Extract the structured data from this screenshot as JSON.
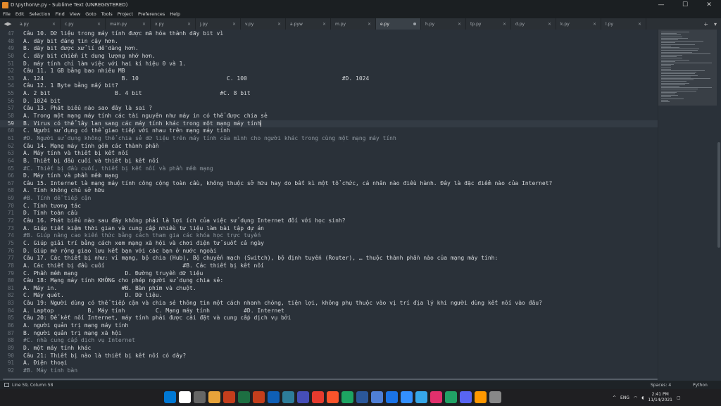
{
  "window": {
    "title": "D:\\python\\e.py - Sublime Text (UNREGISTERED)",
    "minimize": "—",
    "maximize": "☐",
    "close": "✕"
  },
  "menu": [
    "File",
    "Edit",
    "Selection",
    "Find",
    "View",
    "Goto",
    "Tools",
    "Project",
    "Preferences",
    "Help"
  ],
  "tabs": [
    {
      "label": "a.py",
      "active": false
    },
    {
      "label": "c.py",
      "active": false
    },
    {
      "label": "main.py",
      "active": false
    },
    {
      "label": "x.py",
      "active": false
    },
    {
      "label": "j.py",
      "active": false
    },
    {
      "label": "v.py",
      "active": false
    },
    {
      "label": "a.pyw",
      "active": false
    },
    {
      "label": "m.py",
      "active": false
    },
    {
      "label": "e.py",
      "active": true
    },
    {
      "label": "h.py",
      "active": false
    },
    {
      "label": "tp.py",
      "active": false
    },
    {
      "label": "d.py",
      "active": false
    },
    {
      "label": "k.py",
      "active": false
    },
    {
      "label": "l.py",
      "active": false
    }
  ],
  "tab_nav": {
    "prev": "◀",
    "next": "▶",
    "add": "+",
    "more": "▾"
  },
  "editor": {
    "current_line": 59,
    "lines": [
      {
        "n": "47",
        "t": "Câu 10. Dữ liệu trong máy tính được mã hóa thành dãy bit vì",
        "c": false
      },
      {
        "n": "48",
        "t": "A. dãy bit đáng tin cậy hơn.",
        "c": false
      },
      {
        "n": "49",
        "t": "B. dãy bit được xử lí dễ dàng hơn.",
        "c": false
      },
      {
        "n": "50",
        "t": "C. dãy bit chiếm ít dung lượng nhớ hơn.",
        "c": false
      },
      {
        "n": "51",
        "t": "D. máy tính chỉ làm việc với hai kí hiệu 0 và 1.",
        "c": false
      },
      {
        "n": "52",
        "t": "Câu 11. 1 GB bằng bao nhiêu MB",
        "c": false
      },
      {
        "n": "53",
        "t": "A. 124                       B. 10                          C. 100                            #D. 1024",
        "c": false
      },
      {
        "n": "54",
        "t": "Câu 12. 1 Byte bằng mấy bit?",
        "c": false
      },
      {
        "n": "55",
        "t": "A. 2 bit                   B. 4 bit                       #C. 8 bit",
        "c": false
      },
      {
        "n": "56",
        "t": "D. 1024 bit",
        "c": false
      },
      {
        "n": "57",
        "t": "Câu 13. Phát biểu nào sao đây là sai ?",
        "c": false
      },
      {
        "n": "58",
        "t": "A. Trong một mạng máy tính các tài nguyên như máy in có thể được chia sẻ",
        "c": false
      },
      {
        "n": "59",
        "t": "B. Virus có thể lây lan sang các máy tính khác trong một mạng máy tính",
        "c": false
      },
      {
        "n": "60",
        "t": "C. Người sử dụng có thể giao tiếp với nhau trên mạng máy tính",
        "c": false
      },
      {
        "n": "61",
        "t": "#D. Người sử dụng không thể chia sẻ dữ liệu trên máy tính của mình cho người khác trong cùng một mạng máy tính",
        "c": true
      },
      {
        "n": "62",
        "t": "Câu 14. Mạng máy tính gồm các thành phần",
        "c": false
      },
      {
        "n": "63",
        "t": "A. Máy tính và thiết bị kết nối",
        "c": false
      },
      {
        "n": "64",
        "t": "B. Thiết bị đầu cuối và thiết bị kết nối",
        "c": false
      },
      {
        "n": "65",
        "t": "#C. Thiết bị đầu cuối, thiết bị kết nối và phần mềm mạng",
        "c": true
      },
      {
        "n": "66",
        "t": "D. Máy tính và phần mềm mạng",
        "c": false
      },
      {
        "n": "67",
        "t": "Câu 15. Internet là mạng máy tính công cộng toàn cầu, không thuộc sở hữu hay do bất kì một tổ chức, cá nhân nào điều hành. Đây là đặc điểm nào của Internet?",
        "c": false
      },
      {
        "n": "68",
        "t": "A. Tính không chủ sở hữu",
        "c": false
      },
      {
        "n": "69",
        "t": "#B. Tính dễ tiếp cận",
        "c": true
      },
      {
        "n": "70",
        "t": "C. Tính tương tác",
        "c": false
      },
      {
        "n": "71",
        "t": "D. Tính toàn cầu",
        "c": false
      },
      {
        "n": "72",
        "t": "Câu 16. Phát biểu nào sau đây không phải là lợi ích của việc sử dụng Internet đối với học sinh?",
        "c": false
      },
      {
        "n": "73",
        "t": "A. Giúp tiết kiệm thời gian và cung cấp nhiều tư liệu làm bài tập dự án",
        "c": false
      },
      {
        "n": "74",
        "t": "#B. Giúp nâng cao kiến thức bằng cách tham gia các khóa học trực tuyến",
        "c": true
      },
      {
        "n": "75",
        "t": "C. Giúp giải trí bằng cách xem mạng xã hội và chơi điện tử suốt cả ngày",
        "c": false
      },
      {
        "n": "76",
        "t": "D. Giúp mở rộng giao lưu kết bạn với các bạn ở nước ngoài",
        "c": false
      },
      {
        "n": "77",
        "t": "Câu 17. Các thiết bị như: vỉ mạng, bộ chia (Hub), Bộ chuyển mạch (Switch), bộ định tuyến (Router), … thuộc thành phần nào của mạng máy tính:",
        "c": false
      },
      {
        "n": "78",
        "t": "A. Các thiết bị đầu cuối                       #B. Các thiết bị kết nối",
        "c": false
      },
      {
        "n": "79",
        "t": "C. Phần mềm mạng              D. Đường truyền dữ liệu",
        "c": false
      },
      {
        "n": "80",
        "t": "Câu 18: Mạng máy tính KHÔNG cho phép người sử dụng chia sẻ:",
        "c": false
      },
      {
        "n": "81",
        "t": "A. Máy in.                   #B. Bàn phím và chuột.",
        "c": false
      },
      {
        "n": "82",
        "t": "C. Máy quét.                  D. Dữ liệu.",
        "c": false
      },
      {
        "n": "83",
        "t": "Câu 19: Người dùng có thể tiếp cận và chia sẻ thông tin một cách nhanh chóng, tiện lợi, không phụ thuộc vào vị trí địa lý khi người dùng kết nối vào đâu?",
        "c": false
      },
      {
        "n": "84",
        "t": "A. Laptop          B. Máy tính         C. Mạng máy tính          #D. Internet",
        "c": false
      },
      {
        "n": "85",
        "t": "Câu 20: Để kết nối Internet, máy tính phải được cài đặt và cung cấp dịch vụ bởi",
        "c": false
      },
      {
        "n": "86",
        "t": "A. người quản trị mạng máy tính",
        "c": false
      },
      {
        "n": "87",
        "t": "B. người quản trị mạng xã hội",
        "c": false
      },
      {
        "n": "88",
        "t": "#C. nhà cung cấp dịch vụ Internet",
        "c": true
      },
      {
        "n": "89",
        "t": "D. một máy tính khác",
        "c": false
      },
      {
        "n": "90",
        "t": "Câu 21: Thiết bị nào là thiết bị kết nối có dây?",
        "c": false
      },
      {
        "n": "91",
        "t": "A. Điện thoại",
        "c": false
      },
      {
        "n": "92",
        "t": "#B. Máy tính bàn",
        "c": true
      }
    ]
  },
  "status": {
    "position": "Line 59, Column 58",
    "indent": "Spaces: 4",
    "syntax": "Python"
  },
  "taskbar": {
    "lang": "ENG",
    "time": "2:41 PM",
    "date": "11/14/2021",
    "app_colors": [
      "#0078d4",
      "#ffffff",
      "#666666",
      "#e8a33a",
      "#c43e1c",
      "#1d6f42",
      "#c43e1c",
      "#0f5fb6",
      "#2d7d9a",
      "#464eb8",
      "#e63b2e",
      "#fb542b",
      "#1da462",
      "#2b579a",
      "#4f7fd6",
      "#1a73e8",
      "#3390ff",
      "#36a7e9",
      "#e1306c",
      "#21a366",
      "#5865f2",
      "#ff9800",
      "#888888"
    ]
  },
  "colors": {
    "editor_bg": "#2a3139",
    "comment": "#8e979f",
    "text": "#d4d7da",
    "number": "#f0a44d",
    "keyword": "#4aa7d6"
  }
}
